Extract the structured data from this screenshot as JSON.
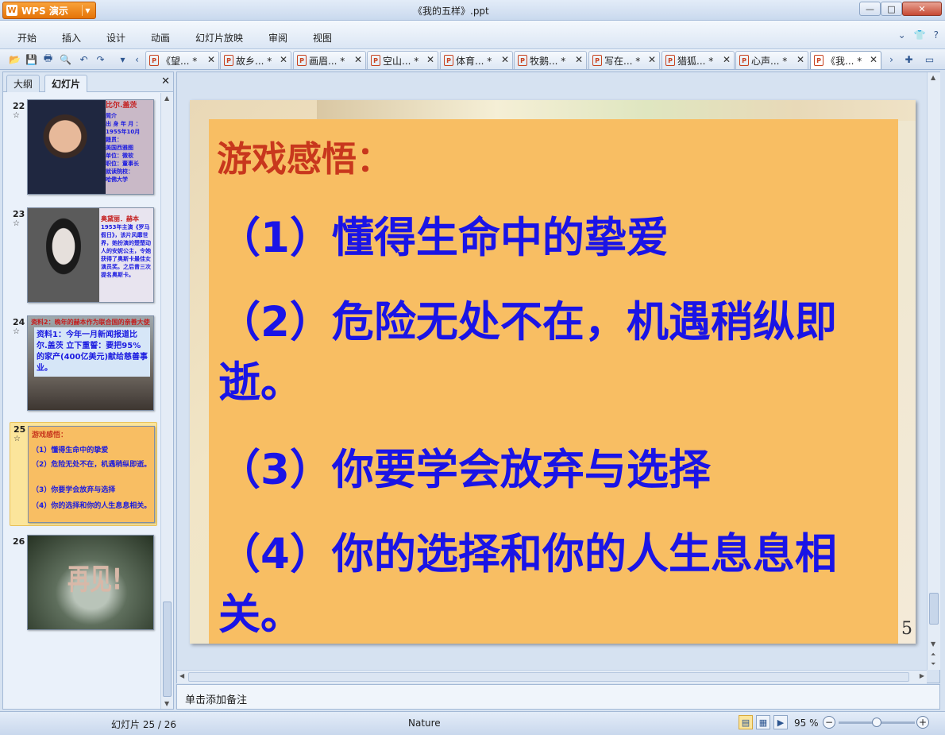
{
  "app": {
    "name": "WPS 演示",
    "logo": "W",
    "window_title": "《我的五样》.ppt"
  },
  "window_controls": {
    "minimize": "—",
    "maximize": "□",
    "close": "✕"
  },
  "menu": {
    "items": [
      "开始",
      "插入",
      "设计",
      "动画",
      "幻灯片放映",
      "审阅",
      "视图"
    ],
    "right_icons": [
      "chevron-down-icon",
      "shirt-icon",
      "help-icon"
    ]
  },
  "doc_tabs": [
    {
      "label": "《望... *",
      "active": false
    },
    {
      "label": "故乡... *",
      "active": false
    },
    {
      "label": "画眉... *",
      "active": false
    },
    {
      "label": "空山... *",
      "active": false
    },
    {
      "label": "体育... *",
      "active": false
    },
    {
      "label": "牧鹅... *",
      "active": false
    },
    {
      "label": "写在... *",
      "active": false
    },
    {
      "label": "猎狐... *",
      "active": false
    },
    {
      "label": "心声... *",
      "active": false
    },
    {
      "label": "《我... *",
      "active": true
    }
  ],
  "left_pane": {
    "tabs": [
      "大纲",
      "幻灯片"
    ],
    "active_tab": "幻灯片",
    "slides": [
      {
        "num": "22",
        "title": "比尔.盖茨",
        "text": "简介\n出 身 年 月 ：\n1955年10月\n籍贯：\n美国西雅图\n单位：微软\n职位：董事长\n就读院校：\n哈佛大学"
      },
      {
        "num": "23",
        "title": "奥黛丽．赫本",
        "text": "1953年主演《罗马假日》，该片风靡世界，她扮演的楚楚动人的安妮公主，令她获得了奥斯卡最佳女演员奖。之后曾三次提名奥斯卡。"
      },
      {
        "num": "24",
        "title": "资料2：晚年的赫本作为联合国的亲善大使",
        "text": "资料1：今年一月新闻报道比尔.盖茨 立下重誓：要把95%的家产(400亿美元)献给慈善事业。"
      },
      {
        "num": "25",
        "lines": [
          "游戏感悟：",
          "（1）懂得生命中的挚爱",
          "（2）危险无处不在，机遇稍纵即逝。",
          "（3）你要学会放弃与选择",
          "（4）你的选择和你的人生息息相关。"
        ]
      },
      {
        "num": "26",
        "caption": "再见!"
      }
    ]
  },
  "slide": {
    "heading": "游戏感悟：",
    "lines": [
      "（1）懂得生命中的挚爱",
      "（2）危险无处不在，机遇稍纵即逝。",
      "（3）你要学会放弃与选择",
      "（4）你的选择和你的人生息息相关。"
    ],
    "page_number": "5",
    "colors": {
      "heading": "#c8371d",
      "body": "#1a14e6",
      "box": "#f8be63"
    }
  },
  "notes": {
    "placeholder": "单击添加备注"
  },
  "status": {
    "slide_info": "幻灯片 25 / 26",
    "theme": "Nature",
    "zoom": "95 %",
    "zoom_fraction": 0.5
  }
}
